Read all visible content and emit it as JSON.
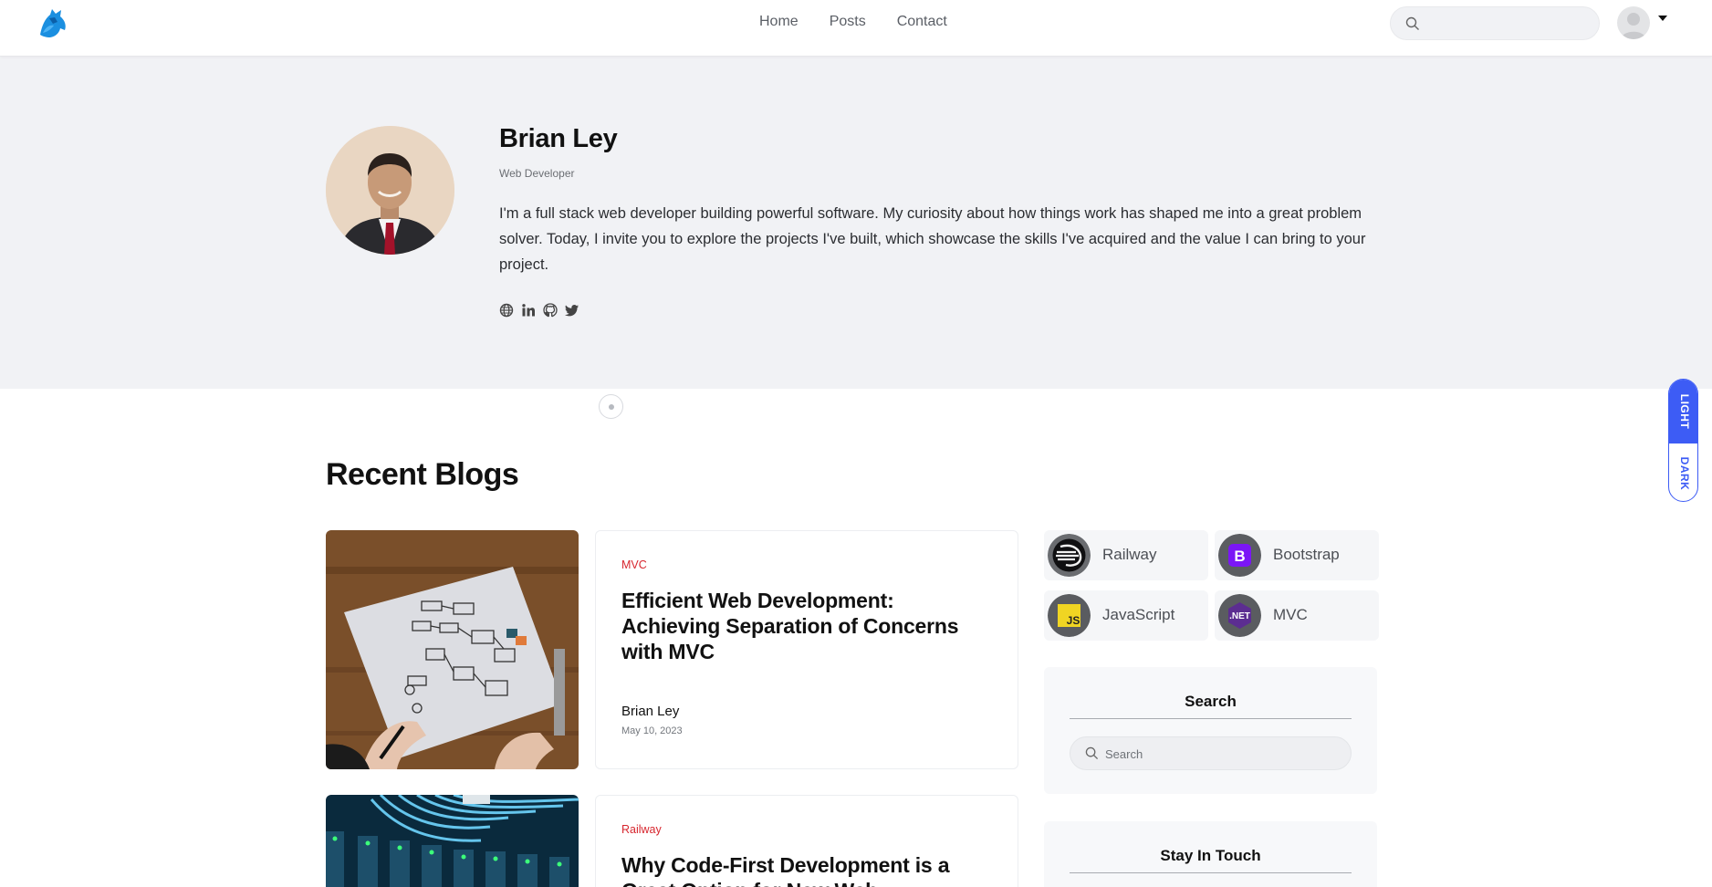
{
  "header": {
    "nav": [
      "Home",
      "Posts",
      "Contact"
    ],
    "search_placeholder": ""
  },
  "hero": {
    "name": "Brian Ley",
    "role": "Web Developer",
    "bio": "I'm a full stack web developer building powerful software. My curiosity about how things work has shaped me into a great problem solver. Today, I invite you to explore the projects I've built, which showcase the skills I've acquired and the value I can bring to your project.",
    "social_icons": [
      "globe-icon",
      "linkedin-icon",
      "github-icon",
      "twitter-icon"
    ]
  },
  "theme_toggle": {
    "light": "LIGHT",
    "dark": "DARK"
  },
  "main": {
    "section_title": "Recent Blogs",
    "posts": [
      {
        "category": "MVC",
        "title": "Efficient Web Development: Achieving Separation of Concerns with MVC",
        "author": "Brian Ley",
        "date": "May 10, 2023"
      },
      {
        "category": "Railway",
        "title": "Why Code-First Development is a Great Option for New Web",
        "author": "",
        "date": ""
      }
    ]
  },
  "sidebar": {
    "tags": [
      "Railway",
      "Bootstrap",
      "JavaScript",
      "MVC"
    ],
    "search_title": "Search",
    "search_placeholder": "Search",
    "stay_title": "Stay In Touch"
  },
  "colors": {
    "accent": "#3d5cf5",
    "category": "#d7262e",
    "hero_bg": "#f1f2f5"
  }
}
